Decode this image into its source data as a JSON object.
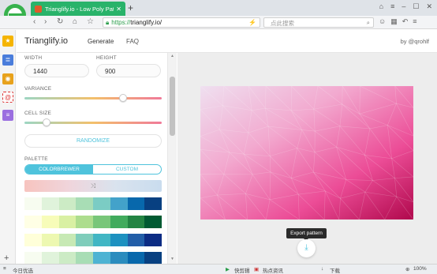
{
  "browser": {
    "tab_title": "Trianglify.io - Low Poly Pattern",
    "url_scheme": "https://",
    "url_rest": "trianglify.io/",
    "search_placeholder": "点此搜索"
  },
  "header": {
    "logo": "Trianglify.io",
    "nav": [
      "Generate",
      "FAQ"
    ],
    "byline": "by @qrohlf"
  },
  "controls": {
    "width_label": "WIDTH",
    "width_value": "1440",
    "height_label": "HEIGHT",
    "height_value": "900",
    "variance_label": "VARIANCE",
    "variance_level": 0.72,
    "cell_size_label": "CELL SIZE",
    "cell_size_level": 0.16,
    "randomize_label": "RANDOMIZE",
    "palette_label": "PALETTE",
    "palette_tabs": [
      "COLORBREWER",
      "CUSTOM"
    ],
    "active_palette_tab": "COLORBREWER"
  },
  "palettes": [
    [
      "#f7fcf0",
      "#e0f3db",
      "#ccebc5",
      "#a8ddb5",
      "#7bccc4",
      "#43a2ca",
      "#0868ac",
      "#084081"
    ],
    [
      "#ffffe5",
      "#f7fcb9",
      "#d9f0a3",
      "#addd8e",
      "#78c679",
      "#41ab5d",
      "#238443",
      "#005a32"
    ],
    [
      "#ffffd9",
      "#edf8b1",
      "#c7e9b4",
      "#7fcdbb",
      "#41b6c4",
      "#1d91c0",
      "#225ea8",
      "#0c2c84"
    ],
    [
      "#f7fcf0",
      "#e0f3db",
      "#ccebc5",
      "#a8ddb5",
      "#4eb3d3",
      "#2b8cbe",
      "#0868ac",
      "#084081"
    ],
    [
      "#f7fcfd",
      "#e5f5f9",
      "#ccece6",
      "#99d8c9",
      "#66c2a4",
      "#41ae76",
      "#238b45",
      "#005824"
    ]
  ],
  "preview": {
    "export_tooltip": "Export pattern",
    "gradient_colors": [
      "#efe0f0",
      "#f2a9cf",
      "#ec4d97",
      "#b0084c"
    ]
  },
  "statusbar": {
    "left": "今日优选",
    "items": [
      "快剪辑",
      "热点资讯",
      "下载",
      "100%"
    ]
  }
}
